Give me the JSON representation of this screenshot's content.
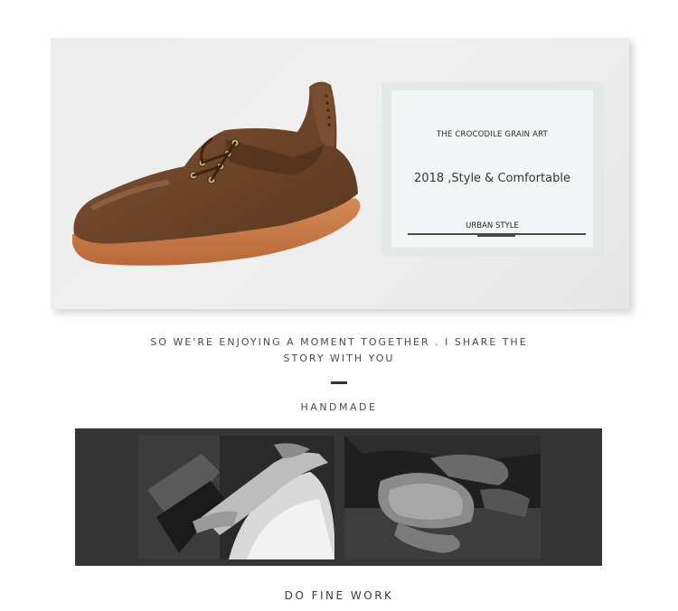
{
  "hero": {
    "image": "brown-leather-lace-up-shoe",
    "card": {
      "top_label": "THE CROCODILE GRAIN ART",
      "headline": "2018 ,Style & Comfortable",
      "sub_label": "URBAN STYLE"
    }
  },
  "story": {
    "line1": "SO WE'RE ENJOYING A MOMENT TOGETHER . I SHARE THE",
    "line2": "STORY WITH YOU"
  },
  "section_title": "HANDMADE",
  "photos": [
    {
      "image": "hands-working-leather-bw"
    },
    {
      "image": "hands-shaping-shoe-last-bw"
    }
  ],
  "footer_title": "DO FINE WORK"
}
